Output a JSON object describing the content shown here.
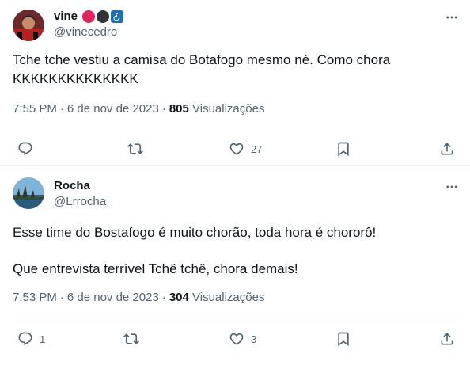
{
  "colors": {
    "text_primary": "#0f1419",
    "text_secondary": "#536471",
    "divider": "#eff3f4",
    "icon": "#536471",
    "badge_red": "#e0245e",
    "badge_dark": "#2f3336",
    "badge_blue": "#1d6fb8"
  },
  "tweets": [
    {
      "name": "vine",
      "handle": "@vinecedro",
      "badges": [
        "red-circle-emoji",
        "black-circle-emoji",
        "wheelchair-symbol-emoji"
      ],
      "text_lines": [
        "Tche tche vestiu a camisa do Botafogo mesmo né. Como chora",
        "KKKKKKKKKKKKKK"
      ],
      "time": "7:55 PM",
      "date": "6 de nov de 2023",
      "views_count": "805",
      "views_label": "Visualizações",
      "replies": "",
      "retweets": "",
      "likes": "27"
    },
    {
      "name": "Rocha",
      "handle": "@Lrrocha_",
      "text_paragraphs": [
        "Esse time do Bostafogo é muito chorão, toda hora é chororô!",
        "Que entrevista terrível Tchê tchê, chora demais!"
      ],
      "time": "7:53 PM",
      "date": "6 de nov de 2023",
      "views_count": "304",
      "views_label": "Visualizações",
      "replies": "1",
      "retweets": "",
      "likes": "3"
    }
  ]
}
